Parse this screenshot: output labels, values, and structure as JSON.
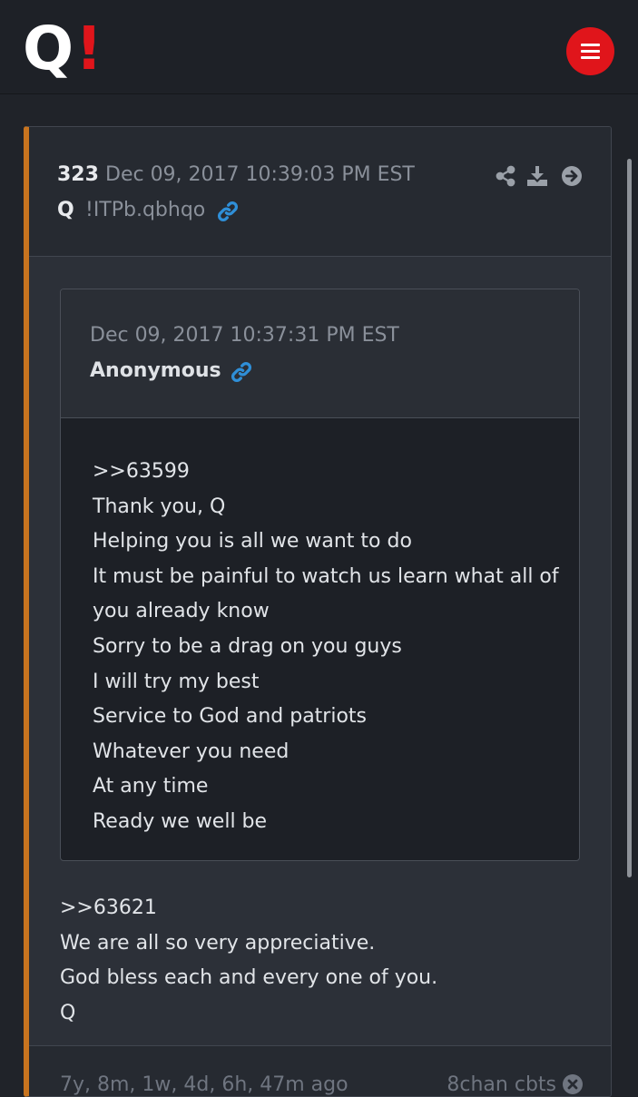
{
  "header": {
    "logo_letter": "Q",
    "logo_mark": "!",
    "menu_icon": "hamburger-menu-icon",
    "accent_color": "#e0151b"
  },
  "post": {
    "number": "323",
    "date": "Dec 09, 2017 10:39:03 PM EST",
    "author": "Q",
    "tripcode": "!ITPb.qbhqo",
    "accent_color": "#c8741f",
    "icons": [
      "share-icon",
      "download-icon",
      "arrow-right-circle-icon",
      "link-icon"
    ],
    "quoted": {
      "date": "Dec 09, 2017 10:37:31 PM EST",
      "author": "Anonymous",
      "lines": [
        ">>63599",
        "Thank you, Q",
        "Helping you is all we want to do",
        "It must be painful to watch us learn what all of",
        "you already know",
        "Sorry to be a drag on you guys",
        "I will try my best",
        "Service to God and patriots",
        "Whatever you need",
        "At any time",
        "Ready we well be"
      ]
    },
    "reply_lines": [
      ">>63621",
      "We are all so very appreciative.",
      "God bless each and every one of you.",
      "Q"
    ],
    "footer": {
      "ago": "7y, 8m, 1w, 4d, 6h, 47m ago",
      "source": "8chan cbts"
    }
  }
}
